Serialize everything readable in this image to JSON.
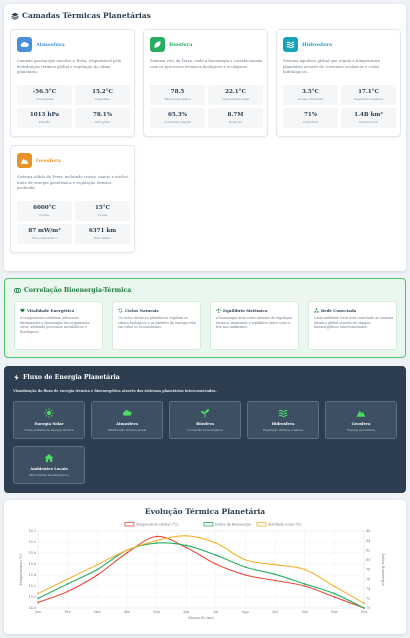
{
  "layers_section": {
    "title": "Camadas Térmicas Planetárias",
    "cards": [
      {
        "name": "Atmosfera",
        "color": "#4a90d9",
        "icon": "cloud-icon",
        "description": "Camada gasosa que envolve a Terra, responsável pela distribuição térmica global e regulação do clima planetário.",
        "stats": [
          {
            "value": "-56.5°C",
            "label": "Tropopausa"
          },
          {
            "value": "15.2°C",
            "label": "Superfície"
          },
          {
            "value": "1013 hPa",
            "label": "Pressão"
          },
          {
            "value": "78.1%",
            "label": "Nitrogênio"
          }
        ]
      },
      {
        "name": "Biosfera",
        "color": "#27ae60",
        "icon": "leaf-icon",
        "description": "Sistema vivo da Terra, onde a bioenergia e correlacionada com os processos térmicos biológicos e ecológicos.",
        "stats": [
          {
            "value": "78.5",
            "label": "Bioenergia Índice"
          },
          {
            "value": "22.1°C",
            "label": "Temperatura Ideal"
          },
          {
            "value": "65.3%",
            "label": "Cobertura Vegetal"
          },
          {
            "value": "8.7M",
            "label": "Espécies"
          }
        ]
      },
      {
        "name": "Hidrosfera",
        "color": "#16a3b8",
        "icon": "water-icon",
        "description": "Sistema aquático global que regula a temperatura planetária através de correntes oceânicas e ciclos hidrológicos.",
        "stats": [
          {
            "value": "3.5°C",
            "label": "Oceano Profundo"
          },
          {
            "value": "17.1°C",
            "label": "Superfície Oceânica"
          },
          {
            "value": "71%",
            "label": "Cobertura"
          },
          {
            "value": "1.4B km³",
            "label": "Volume Total"
          }
        ]
      },
      {
        "name": "Geosfera",
        "color": "#e8922a",
        "icon": "mountain-icon",
        "description": "Sistema sólido da Terra, incluindo crosta, manto e núcleo, fonte de energia geotérmica e regulação térmica profunda.",
        "stats": [
          {
            "value": "6000°C",
            "label": "Núcleo"
          },
          {
            "value": "15°C",
            "label": "Crosta"
          },
          {
            "value": "87 mW/m²",
            "label": "Fluxo Geotérmico"
          },
          {
            "value": "6371 km",
            "label": "Raio Médio"
          }
        ]
      }
    ]
  },
  "correlation_section": {
    "title": "Correlação Bioenergia-Térmica",
    "items": [
      {
        "name": "Vitalidade Energética",
        "icon": "heart-icon",
        "description": "A temperatura ambiente influencia diretamente a bioenergia dos organismos vivos, afetando processos metabólicos e fisiológicos."
      },
      {
        "name": "Ciclos Naturais",
        "icon": "cycle-icon",
        "description": "Os ciclos térmicos planetários regulam os ritmos biológicos e os padrões de energia vital em todos os ecossistemas."
      },
      {
        "name": "Equilíbrio Sistêmico",
        "icon": "balance-icon",
        "description": "A bioenergia atua como sistema de regulação térmica, mantendo o equilíbrio entre calor e frio nos ambientes."
      },
      {
        "name": "Rede Conectada",
        "icon": "network-icon",
        "description": "Cada ambiente local está conectado ao sistema térmico global através de campos bioenergéticos interconectados."
      }
    ]
  },
  "flow_section": {
    "title": "Fluxo de Energia Planetária",
    "subtitle": "Visualização do fluxo de energia térmica e bioenergética através dos sistemas planetários interconectados.",
    "nodes": [
      {
        "name": "Energia Solar",
        "icon": "sun-icon",
        "description": "Fonte primária de energia térmica"
      },
      {
        "name": "Atmosfera",
        "icon": "cloud-icon",
        "description": "Distribuição térmica global"
      },
      {
        "name": "Biosfera",
        "icon": "sprout-icon",
        "description": "Conversão bioenergética"
      },
      {
        "name": "Hidrosfera",
        "icon": "water-icon",
        "description": "Regulação térmica oceânica"
      },
      {
        "name": "Geosfera",
        "icon": "mountain-icon",
        "description": "Energia geotérmica"
      },
      {
        "name": "Ambientes Locais",
        "icon": "home-icon",
        "description": "Microclimas bioenergéticos"
      }
    ]
  },
  "chart_section": {
    "title": "Evolução Térmica Planetária",
    "chart_data": {
      "type": "line",
      "title": "Evolução Térmica Planetária",
      "xlabel": "Meses do Ano",
      "ylabel_left": "Temperatura (°C)",
      "ylabel_right": "Índice Bioenergia",
      "categories": [
        "Jan",
        "Fev",
        "Mar",
        "Abr",
        "Mai",
        "Jun",
        "Jul",
        "Ago",
        "Set",
        "Out",
        "Nov",
        "Dez"
      ],
      "ylim_left": [
        14.8,
        16.2
      ],
      "yticks_left": [
        "14.8",
        "15.0",
        "15.2",
        "15.4",
        "15.6",
        "15.8",
        "16.0",
        "16.2"
      ],
      "ylim_right": [
        70,
        86
      ],
      "yticks_right": [
        "70",
        "72",
        "74",
        "76",
        "78",
        "80",
        "82",
        "84",
        "86"
      ],
      "grid": true,
      "legend_position": "top",
      "series": [
        {
          "name": "Temperatura Global (°C)",
          "axis": "left",
          "color": "#e74c3c",
          "values": [
            14.9,
            15.1,
            15.4,
            15.8,
            16.1,
            15.9,
            15.6,
            15.4,
            15.3,
            15.2,
            15.0,
            14.8
          ]
        },
        {
          "name": "Índice de Bioenergia",
          "axis": "right",
          "color": "#27ae60",
          "values": [
            72,
            75,
            78,
            82,
            83.5,
            83,
            81,
            78.5,
            77,
            75,
            73,
            70
          ]
        },
        {
          "name": "Atividade Solar (%)",
          "axis": "right",
          "color": "#f0b429",
          "values": [
            73,
            76,
            79,
            82,
            84,
            85,
            83.5,
            80,
            79,
            78,
            74.5,
            71
          ]
        }
      ]
    }
  }
}
